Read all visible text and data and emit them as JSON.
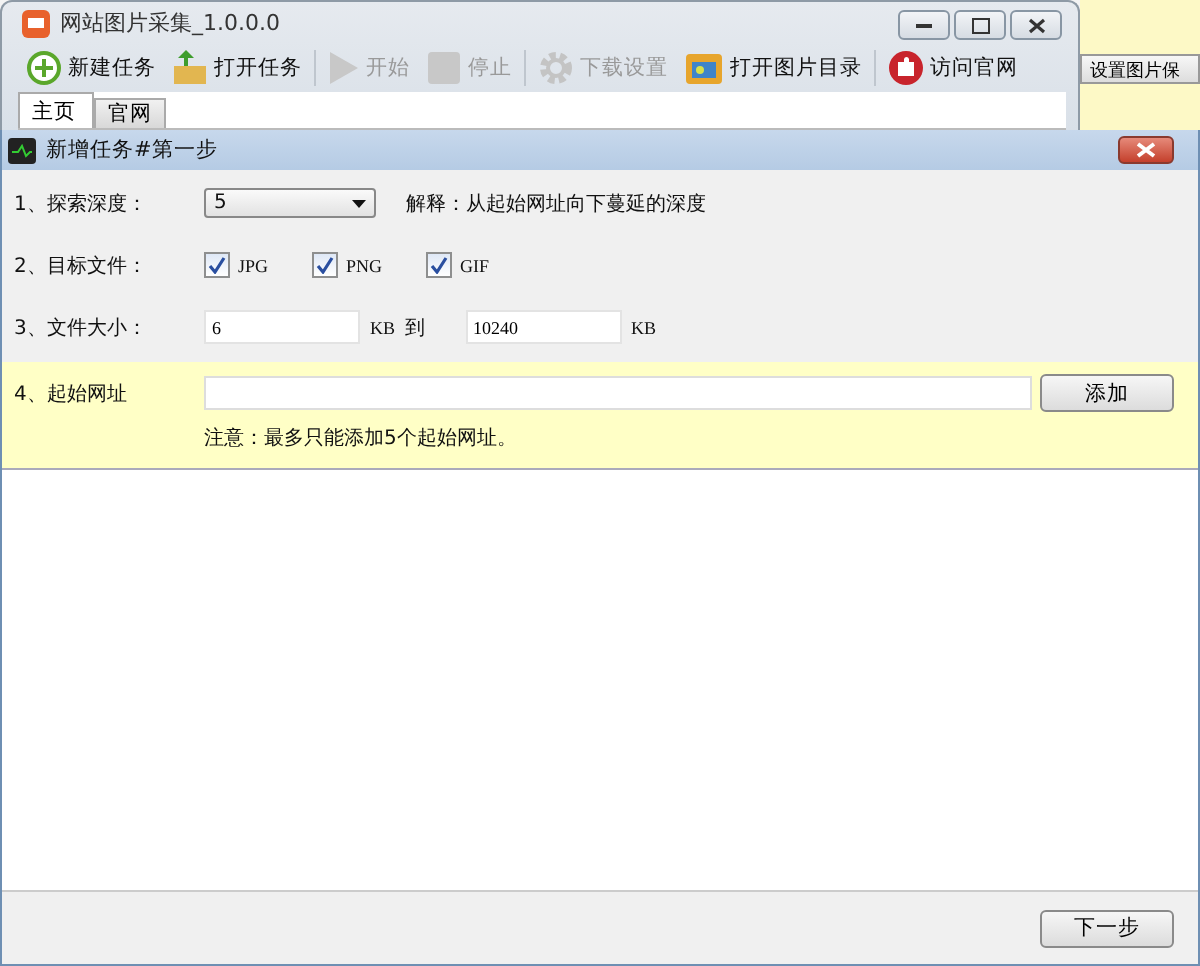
{
  "app_window": {
    "title": "网站图片采集_1.0.0.0",
    "toolbar": [
      {
        "kind": "new",
        "label": "新建任务",
        "disabled": false
      },
      {
        "kind": "open",
        "label": "打开任务",
        "disabled": false
      },
      {
        "kind": "start",
        "label": "开始",
        "disabled": true
      },
      {
        "kind": "stop",
        "label": "停止",
        "disabled": true
      },
      {
        "kind": "settings",
        "label": "下载设置",
        "disabled": true
      },
      {
        "kind": "folder",
        "label": "打开图片目录",
        "disabled": false
      },
      {
        "kind": "web",
        "label": "访问官网",
        "disabled": false
      }
    ],
    "tabs": [
      {
        "label": "主页",
        "selected": true
      },
      {
        "label": "官网",
        "selected": false
      }
    ]
  },
  "side_button": "设置图片保",
  "dialog": {
    "title": "新增任务#第一步",
    "depth": {
      "label": "1、探索深度：",
      "value": "5",
      "note": "解释：从起始网址向下蔓延的深度"
    },
    "types": {
      "label": "2、目标文件：",
      "options": [
        {
          "label": "JPG",
          "checked": true
        },
        {
          "label": "PNG",
          "checked": true
        },
        {
          "label": "GIF",
          "checked": true
        }
      ]
    },
    "size": {
      "label": "3、文件大小：",
      "min": "6",
      "unit1": "KB",
      "to": "到",
      "max": "10240",
      "unit2": "KB"
    },
    "url": {
      "label": "4、起始网址",
      "add_button": "添加",
      "note": "注意：最多只能添加5个起始网址。"
    },
    "next_button": "下一步"
  }
}
